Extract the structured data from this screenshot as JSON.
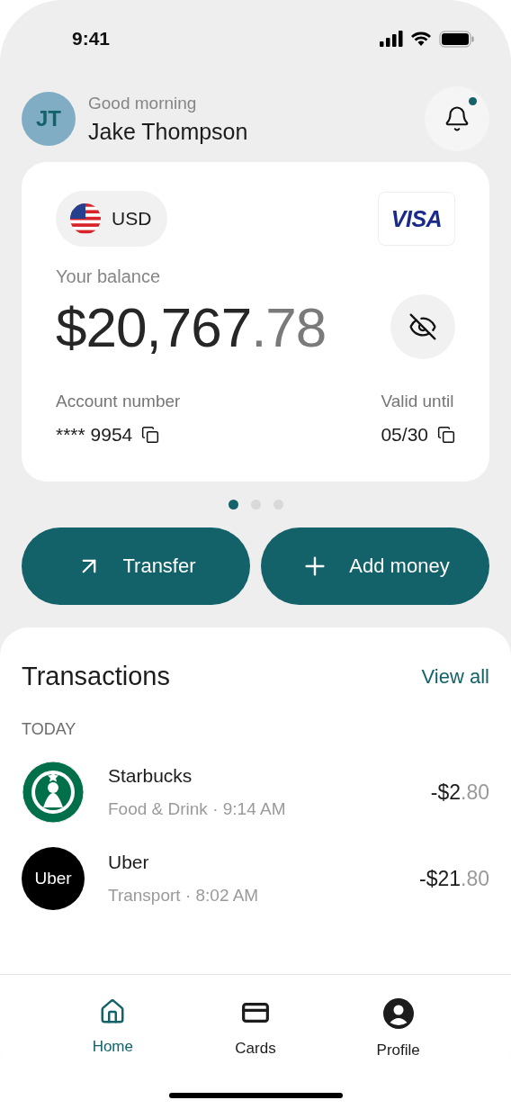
{
  "status_bar": {
    "time": "9:41"
  },
  "header": {
    "greeting": "Good morning",
    "name": "Jake Thompson",
    "initials": "JT",
    "notification": {
      "unread": true
    }
  },
  "card": {
    "currency": "USD",
    "network": "VISA",
    "balance_label": "Your balance",
    "balance_main": "$20,767",
    "balance_cents": ".78",
    "fields": [
      {
        "label": "Account number",
        "value": "**** 9954"
      },
      {
        "label": "Valid until",
        "value": "05/30"
      }
    ]
  },
  "pager": [
    {
      "selected": true
    },
    {
      "selected": false
    },
    {
      "selected": false
    }
  ],
  "actions": [
    {
      "kind": "transfer",
      "label": "Transfer"
    },
    {
      "kind": "add",
      "label": "Add money"
    }
  ],
  "transactions": {
    "title": "Transactions",
    "link": "View all",
    "group": "TODAY",
    "items": [
      {
        "kind": "emblem",
        "name": "Starbucks",
        "meta": "Food & Drink · 9:14 AM",
        "amount_main": "-$2",
        "amount_cents": ".80"
      },
      {
        "kind": "wordmark",
        "logo_text": "Uber",
        "name": "Uber",
        "meta": "Transport · 8:02 AM",
        "amount_main": "-$21",
        "amount_cents": ".80"
      }
    ]
  },
  "nav": [
    {
      "kind": "home",
      "label": "Home",
      "selected": true
    },
    {
      "kind": "cards",
      "label": "Cards",
      "selected": false
    },
    {
      "kind": "profile",
      "label": "Profile",
      "selected": false
    }
  ]
}
